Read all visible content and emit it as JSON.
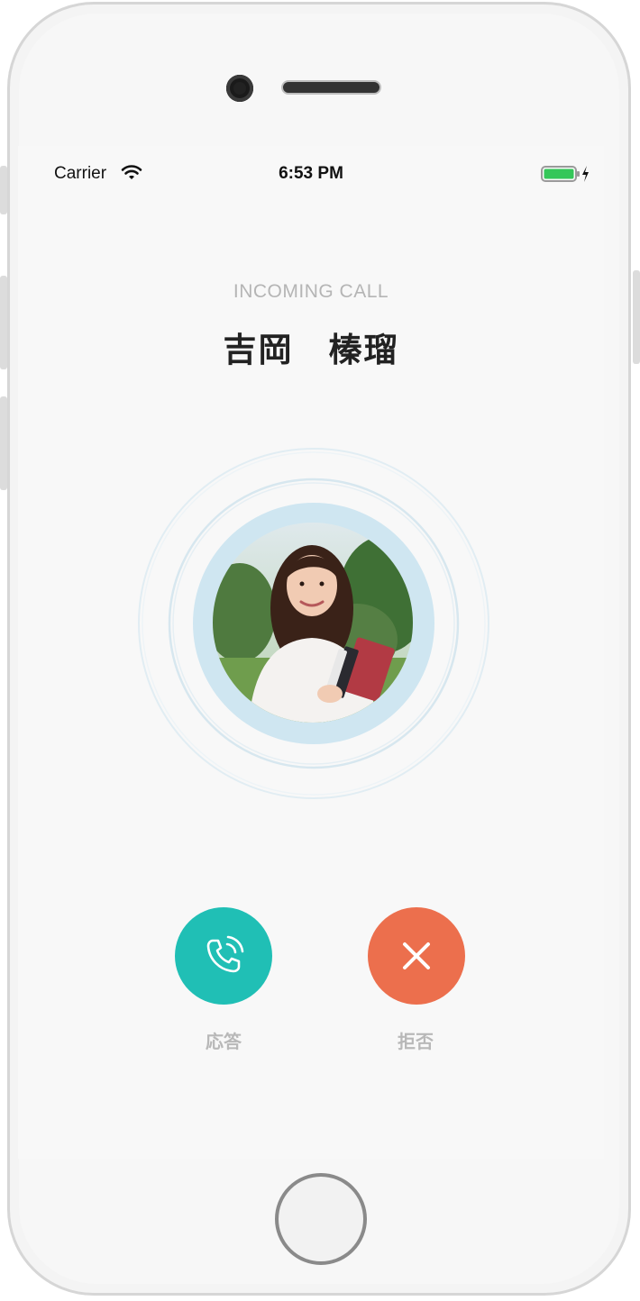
{
  "status_bar": {
    "carrier": "Carrier",
    "time": "6:53 PM",
    "wifi_icon": "wifi-icon",
    "battery_icon": "battery-charging-icon"
  },
  "call": {
    "incoming_label": "INCOMING CALL",
    "caller_name": "吉岡　榛瑠",
    "avatar_icon": "caller-photo"
  },
  "actions": {
    "answer_label": "応答",
    "answer_icon": "phone-ringing-icon",
    "decline_label": "拒否",
    "decline_icon": "close-icon"
  },
  "colors": {
    "answer": "#20bfb5",
    "decline": "#ec6f4d",
    "ring": "#cfe6f1",
    "battery": "#34c759"
  }
}
